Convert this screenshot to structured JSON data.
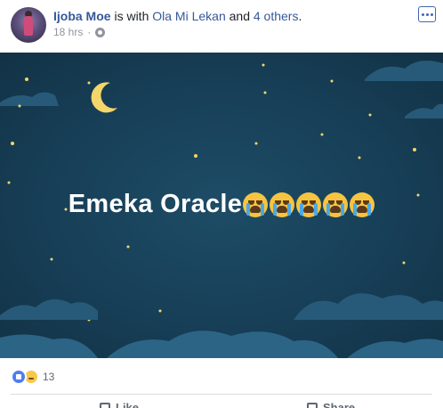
{
  "header": {
    "author": "Ijoba Moe",
    "connector": " is with ",
    "tagged": "Ola Mi Lekan",
    "and_text": " and ",
    "others": "4 others",
    "period": ".",
    "timestamp": "18 hrs",
    "dot": "·"
  },
  "photo": {
    "text": "Emeka Oracle",
    "emoji_count": 5,
    "colors": {
      "sky": "#173f57",
      "cloud": "#275a78",
      "moon": "#f5d66a"
    }
  },
  "reactions": {
    "count": "13"
  },
  "actions": {
    "like_label": "Like",
    "share_label": "Share"
  }
}
